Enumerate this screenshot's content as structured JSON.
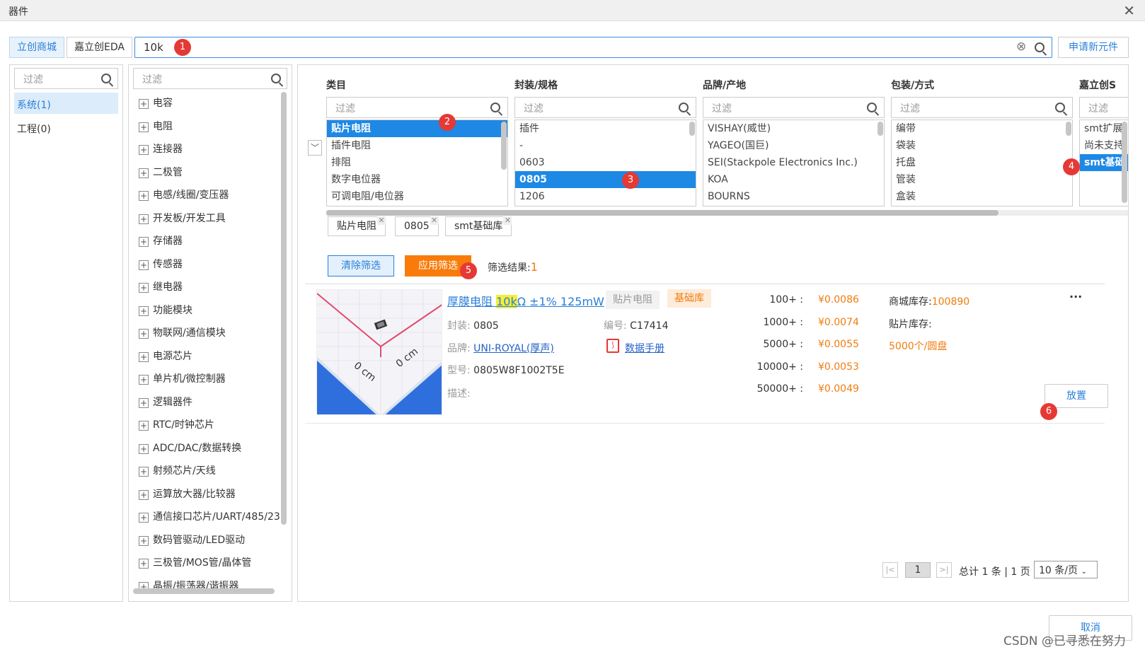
{
  "window": {
    "title": "器件",
    "close": "✕"
  },
  "tabs": [
    {
      "label": "立创商城"
    },
    {
      "label": "嘉立创EDA"
    }
  ],
  "search": {
    "value": "10k",
    "clear": "⊗"
  },
  "request_button": "申请新元件",
  "badges": [
    "1",
    "2",
    "3",
    "4",
    "5",
    "6"
  ],
  "left_panel": {
    "filter_placeholder": "过滤",
    "items": [
      {
        "label": "系统(1)"
      },
      {
        "label": "工程(0)"
      }
    ]
  },
  "tree": {
    "filter_placeholder": "过滤",
    "items": [
      "电容",
      "电阻",
      "连接器",
      "二极管",
      "电感/线圈/变压器",
      "开发板/开发工具",
      "存储器",
      "传感器",
      "继电器",
      "功能模块",
      "物联网/通信模块",
      "电源芯片",
      "单片机/微控制器",
      "逻辑器件",
      "RTC/时钟芯片",
      "ADC/DAC/数据转换",
      "射频芯片/天线",
      "运算放大器/比较器",
      "通信接口芯片/UART/485/23",
      "数码管驱动/LED驱动",
      "三极管/MOS管/晶体管",
      "晶振/振荡器/谐振器"
    ]
  },
  "facets": [
    {
      "title": "类目",
      "placeholder": "过滤",
      "items": [
        "贴片电阻",
        "插件电阻",
        "排阻",
        "数字电位器",
        "可调电阻/电位器"
      ],
      "selected": 0
    },
    {
      "title": "封装/规格",
      "placeholder": "过滤",
      "items": [
        "插件",
        "-",
        "0603",
        "0805",
        "1206"
      ],
      "selected": 3
    },
    {
      "title": "品牌/产地",
      "placeholder": "过滤",
      "items": [
        "VISHAY(威世)",
        "YAGEO(国巨)",
        "SEI(Stackpole Electronics Inc.)",
        "KOA",
        "BOURNS"
      ],
      "selected": -1
    },
    {
      "title": "包装/方式",
      "placeholder": "过滤",
      "items": [
        "编带",
        "袋装",
        "托盘",
        "管装",
        "盒装"
      ],
      "selected": -1
    },
    {
      "title": "嘉立创S",
      "placeholder": "过滤",
      "items": [
        "smt扩展",
        "尚未支持",
        "smt基础"
      ],
      "selected": 2
    }
  ],
  "chips": [
    "贴片电阻",
    "0805",
    "smt基础库"
  ],
  "buttons": {
    "clear": "清除筛选",
    "apply": "应用筛选",
    "result_label": "筛选结果:",
    "result_count": "1"
  },
  "product": {
    "title_pre": "厚膜电阻 ",
    "title_hl": "10k",
    "title_post": "Ω ±1% 125mW",
    "tag_category": "贴片电阻",
    "tag_lib": "基础库",
    "package_label": "封装:",
    "package": "0805",
    "code_label": "编号:",
    "code": "C17414",
    "brand_label": "品牌:",
    "brand": "UNI-ROYAL(厚声)",
    "datasheet": "数据手册",
    "model_label": "型号:",
    "model": "0805W8F1002T5E",
    "desc_label": "描述:",
    "image_labels": [
      "0 cm",
      "0 cm"
    ],
    "prices": [
      {
        "qty": "100+ :",
        "price": "¥0.0086"
      },
      {
        "qty": "1000+ :",
        "price": "¥0.0074"
      },
      {
        "qty": "5000+ :",
        "price": "¥0.0055"
      },
      {
        "qty": "10000+ :",
        "price": "¥0.0053"
      },
      {
        "qty": "50000+ :",
        "price": "¥0.0049"
      }
    ],
    "stock_label": "商城库存:",
    "stock": "100890",
    "smt_stock_label": "贴片库存:",
    "reel": "5000个/圆盘",
    "more": "···",
    "place": "放置"
  },
  "pagination": {
    "first": "|<",
    "page": "1",
    "last": ">|",
    "summary": "总计 1 条 | 1 页",
    "page_size": "10 条/页"
  },
  "footer": {
    "cancel": "取消",
    "watermark": "CSDN @已寻悉在努力"
  }
}
